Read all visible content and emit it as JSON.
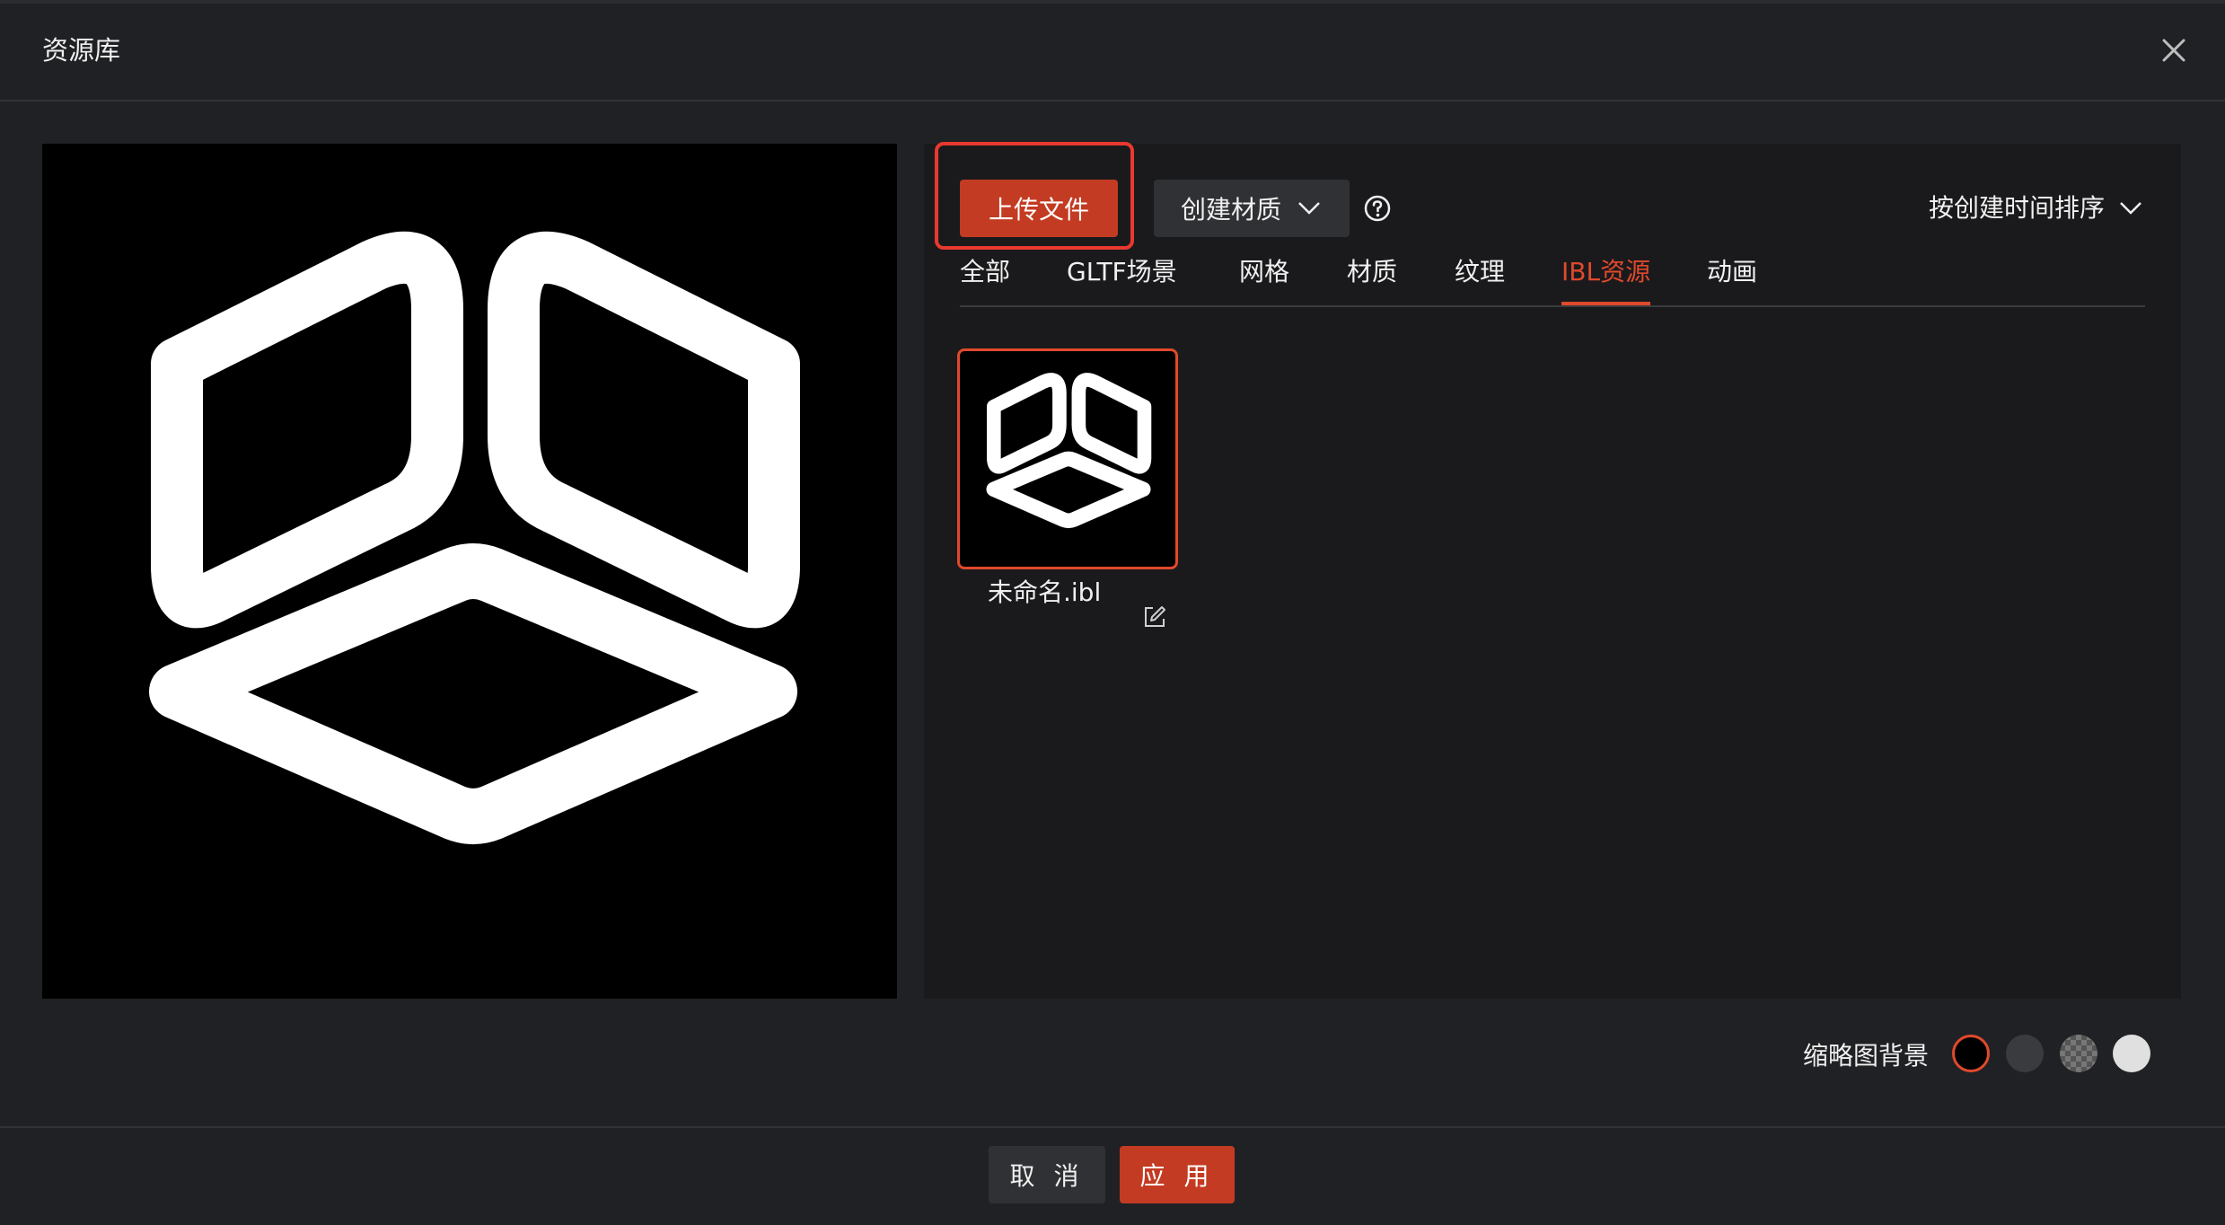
{
  "dialog": {
    "title": "资源库",
    "close_icon": "close-icon"
  },
  "preview": {
    "image": "logo-preview"
  },
  "toolbar": {
    "upload_label": "上传文件",
    "create_label": "创建材质",
    "create_icon": "chevron-down-icon",
    "help_icon": "question-circle-icon",
    "sort_label": "按创建时间排序",
    "sort_icon": "chevron-down-icon"
  },
  "tabs": [
    {
      "label": "全部",
      "active": false
    },
    {
      "label": "GLTF场景",
      "active": false
    },
    {
      "label": "网格",
      "active": false
    },
    {
      "label": "材质",
      "active": false
    },
    {
      "label": "纹理",
      "active": false
    },
    {
      "label": "IBL资源",
      "active": true
    },
    {
      "label": "动画",
      "active": false
    }
  ],
  "assets": [
    {
      "name": "未命名.ibl",
      "selected": true,
      "edit_icon": "edit-icon"
    }
  ],
  "thumbnail_background": {
    "label": "缩略图背景",
    "options": [
      {
        "name": "black",
        "color": "#000000",
        "selected": true
      },
      {
        "name": "dark-gray",
        "color": "#3a3b3e",
        "selected": false
      },
      {
        "name": "checker",
        "color": "#666666",
        "selected": false
      },
      {
        "name": "light-gray",
        "color": "#e0e0e0",
        "selected": false
      }
    ]
  },
  "footer": {
    "cancel_label": "取 消",
    "apply_label": "应 用"
  },
  "colors": {
    "accent": "#e0492c",
    "primary_button": "#c33b22",
    "background": "#202124",
    "panel": "#1a1a1c"
  }
}
